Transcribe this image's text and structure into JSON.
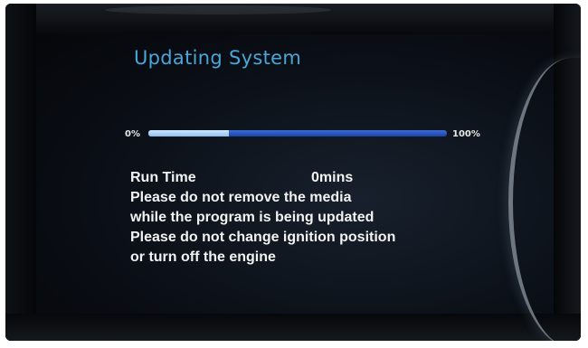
{
  "screen": {
    "title": "Updating System",
    "progress": {
      "start_label": "0%",
      "end_label": "100%",
      "fraction": 0.27,
      "track_color": "#2a57c6",
      "fill_color": "#b7d8f7"
    },
    "run_time": {
      "label": "Run Time",
      "value": "0mins"
    },
    "messages": [
      "Please do not remove the media",
      "while the program is being updated",
      "Please do not change ignition position",
      "or turn off the engine"
    ],
    "title_color": "#4aa6d8"
  }
}
